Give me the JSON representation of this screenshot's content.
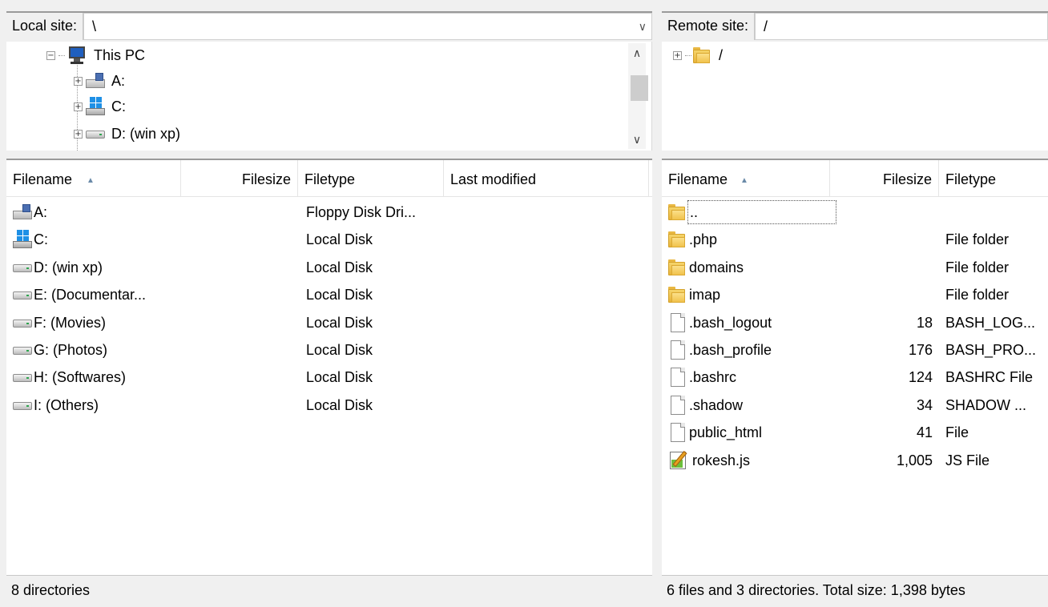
{
  "local": {
    "site_label": "Local site:",
    "site_path": "\\",
    "tree": [
      {
        "label": "This PC",
        "icon": "computer-icon"
      },
      {
        "label": "A:",
        "icon": "floppy-drive-icon"
      },
      {
        "label": "C:",
        "icon": "windows-drive-icon"
      },
      {
        "label": "D: (win xp)",
        "icon": "hard-drive-icon"
      }
    ],
    "columns": {
      "filename": "Filename",
      "filesize": "Filesize",
      "filetype": "Filetype",
      "modified": "Last modified"
    },
    "files": [
      {
        "name": "A:",
        "size": "",
        "type": "Floppy Disk Dri...",
        "icon": "floppy-drive-icon"
      },
      {
        "name": "C:",
        "size": "",
        "type": "Local Disk",
        "icon": "windows-drive-icon"
      },
      {
        "name": "D: (win xp)",
        "size": "",
        "type": "Local Disk",
        "icon": "hard-drive-icon"
      },
      {
        "name": "E: (Documentar...",
        "size": "",
        "type": "Local Disk",
        "icon": "hard-drive-icon"
      },
      {
        "name": "F: (Movies)",
        "size": "",
        "type": "Local Disk",
        "icon": "hard-drive-icon"
      },
      {
        "name": "G: (Photos)",
        "size": "",
        "type": "Local Disk",
        "icon": "hard-drive-icon"
      },
      {
        "name": "H: (Softwares)",
        "size": "",
        "type": "Local Disk",
        "icon": "hard-drive-icon"
      },
      {
        "name": "I: (Others)",
        "size": "",
        "type": "Local Disk",
        "icon": "hard-drive-icon"
      }
    ],
    "status": "8 directories"
  },
  "remote": {
    "site_label": "Remote site:",
    "site_path": "/",
    "tree": [
      {
        "label": "/",
        "icon": "folder-icon"
      }
    ],
    "columns": {
      "filename": "Filename",
      "filesize": "Filesize",
      "filetype": "Filetype"
    },
    "files": [
      {
        "name": "..",
        "size": "",
        "type": "",
        "icon": "folder-icon"
      },
      {
        "name": ".php",
        "size": "",
        "type": "File folder",
        "icon": "folder-icon"
      },
      {
        "name": "domains",
        "size": "",
        "type": "File folder",
        "icon": "folder-icon"
      },
      {
        "name": "imap",
        "size": "",
        "type": "File folder",
        "icon": "folder-icon"
      },
      {
        "name": ".bash_logout",
        "size": "18",
        "type": "BASH_LOG...",
        "icon": "file-icon"
      },
      {
        "name": ".bash_profile",
        "size": "176",
        "type": "BASH_PRO...",
        "icon": "file-icon"
      },
      {
        "name": ".bashrc",
        "size": "124",
        "type": "BASHRC File",
        "icon": "file-icon"
      },
      {
        "name": ".shadow",
        "size": "34",
        "type": "SHADOW ...",
        "icon": "file-icon"
      },
      {
        "name": "public_html",
        "size": "41",
        "type": "File",
        "icon": "file-icon"
      },
      {
        "name": "rokesh.js",
        "size": "1,005",
        "type": "JS File",
        "icon": "js-file-icon"
      }
    ],
    "status": "6 files and 3 directories. Total size: 1,398 bytes"
  }
}
